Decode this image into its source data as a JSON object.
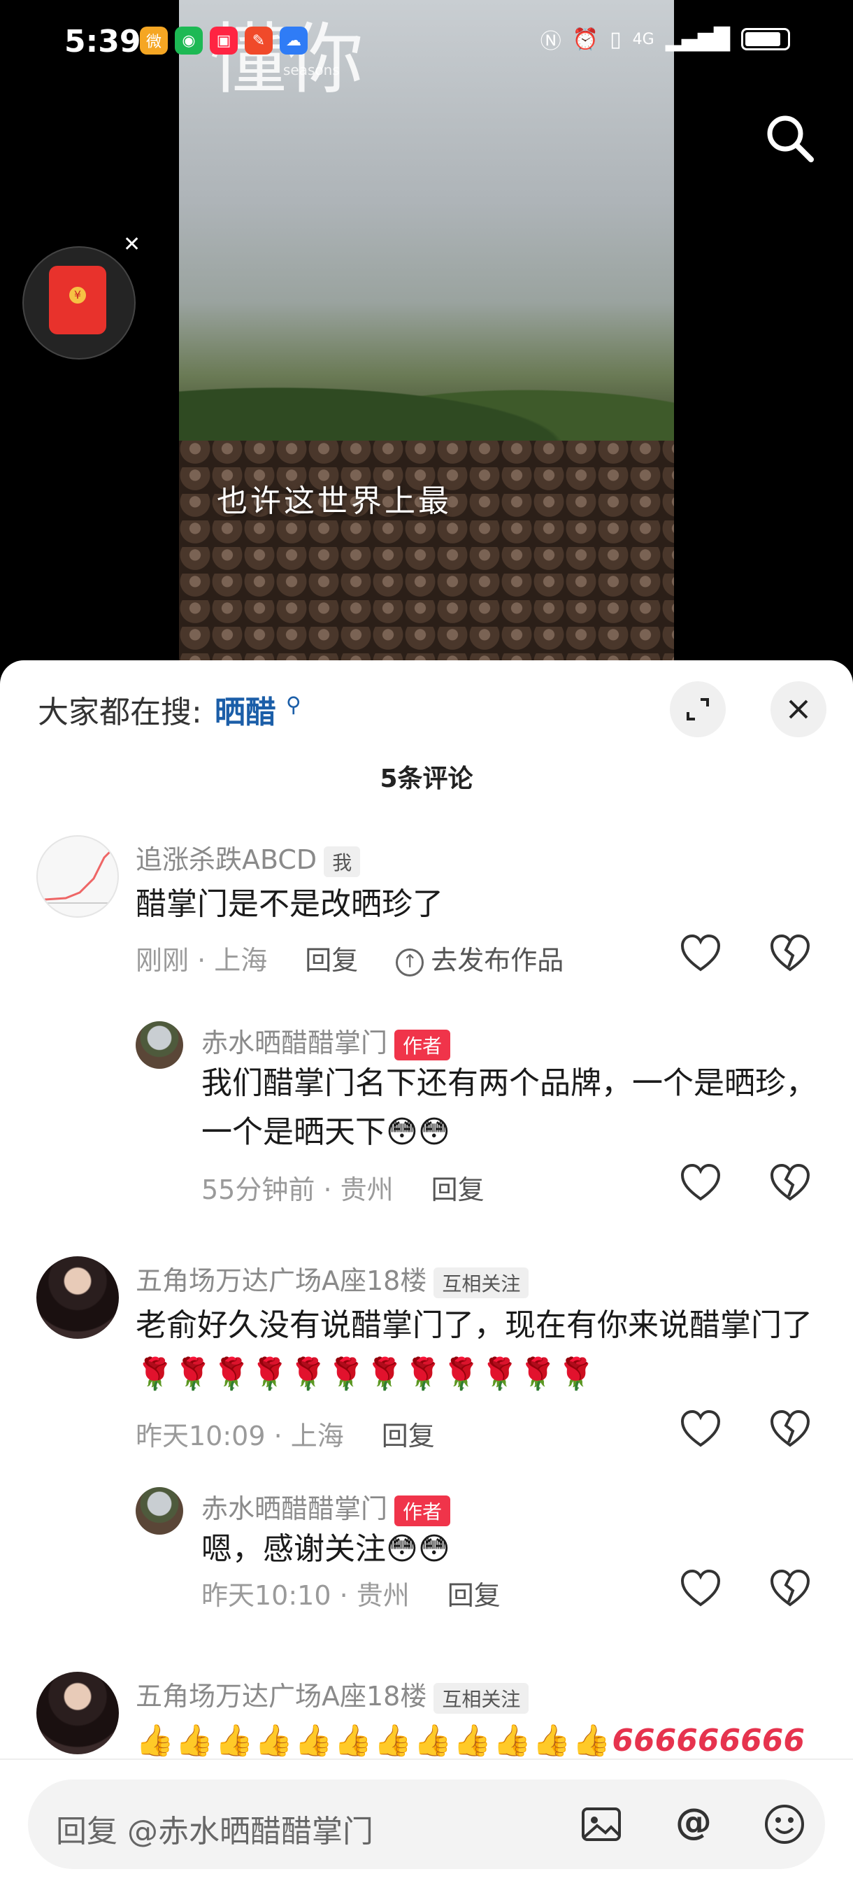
{
  "status_bar": {
    "time": "5:39",
    "apps": [
      {
        "name": "weibo-icon",
        "color": "#f5a623",
        "glyph": "微"
      },
      {
        "name": "wechat-icon",
        "color": "#1db954",
        "glyph": "◉"
      },
      {
        "name": "xiaohongshu-icon",
        "color": "#ff2442",
        "glyph": "▣"
      },
      {
        "name": "toutiao-icon",
        "color": "#f04a2a",
        "glyph": "✎"
      },
      {
        "name": "weather-icon",
        "color": "#2f7cf6",
        "glyph": "☁"
      }
    ],
    "network": "4G"
  },
  "video": {
    "watermark_big": "懂你",
    "watermark_small": "seasons",
    "subtitle": "也许这世界上最"
  },
  "sheet": {
    "hot_search_label": "大家都在搜:",
    "hot_search_keyword": "晒醋",
    "comment_count": "5条评论"
  },
  "comments": [
    {
      "user": "追涨杀跌ABCD",
      "tag": "我",
      "text": "醋掌门是不是改晒珍了",
      "time": "刚刚",
      "location": "上海",
      "reply_label": "回复",
      "publish_label": "去发布作品"
    },
    {
      "user": "赤水晒醋醋掌门",
      "tag": "作者",
      "text": "我们醋掌门名下还有两个品牌，一个是晒珍，一个是晒天下😳😳",
      "time": "55分钟前",
      "location": "贵州",
      "reply_label": "回复"
    },
    {
      "user": "五角场万达广场A座18楼",
      "tag": "互相关注",
      "text": "老俞好久没有说醋掌门了，现在有你来说醋掌门了🌹🌹🌹🌹🌹🌹🌹🌹🌹🌹🌹🌹",
      "time": "昨天10:09",
      "location": "上海",
      "reply_label": "回复"
    },
    {
      "user": "赤水晒醋醋掌门",
      "tag": "作者",
      "text": "嗯，感谢关注😳😳",
      "time": "昨天10:10",
      "location": "贵州",
      "reply_label": "回复"
    },
    {
      "user": "五角场万达广场A座18楼",
      "tag": "互相关注",
      "text_thumbs": "👍👍👍👍👍👍👍👍👍👍👍👍",
      "text_six": "666666666"
    }
  ],
  "input": {
    "placeholder": "回复 @赤水晒醋醋掌门"
  },
  "colors": {
    "author_tag": "#f0344a",
    "keyword": "#1b5ea8"
  }
}
